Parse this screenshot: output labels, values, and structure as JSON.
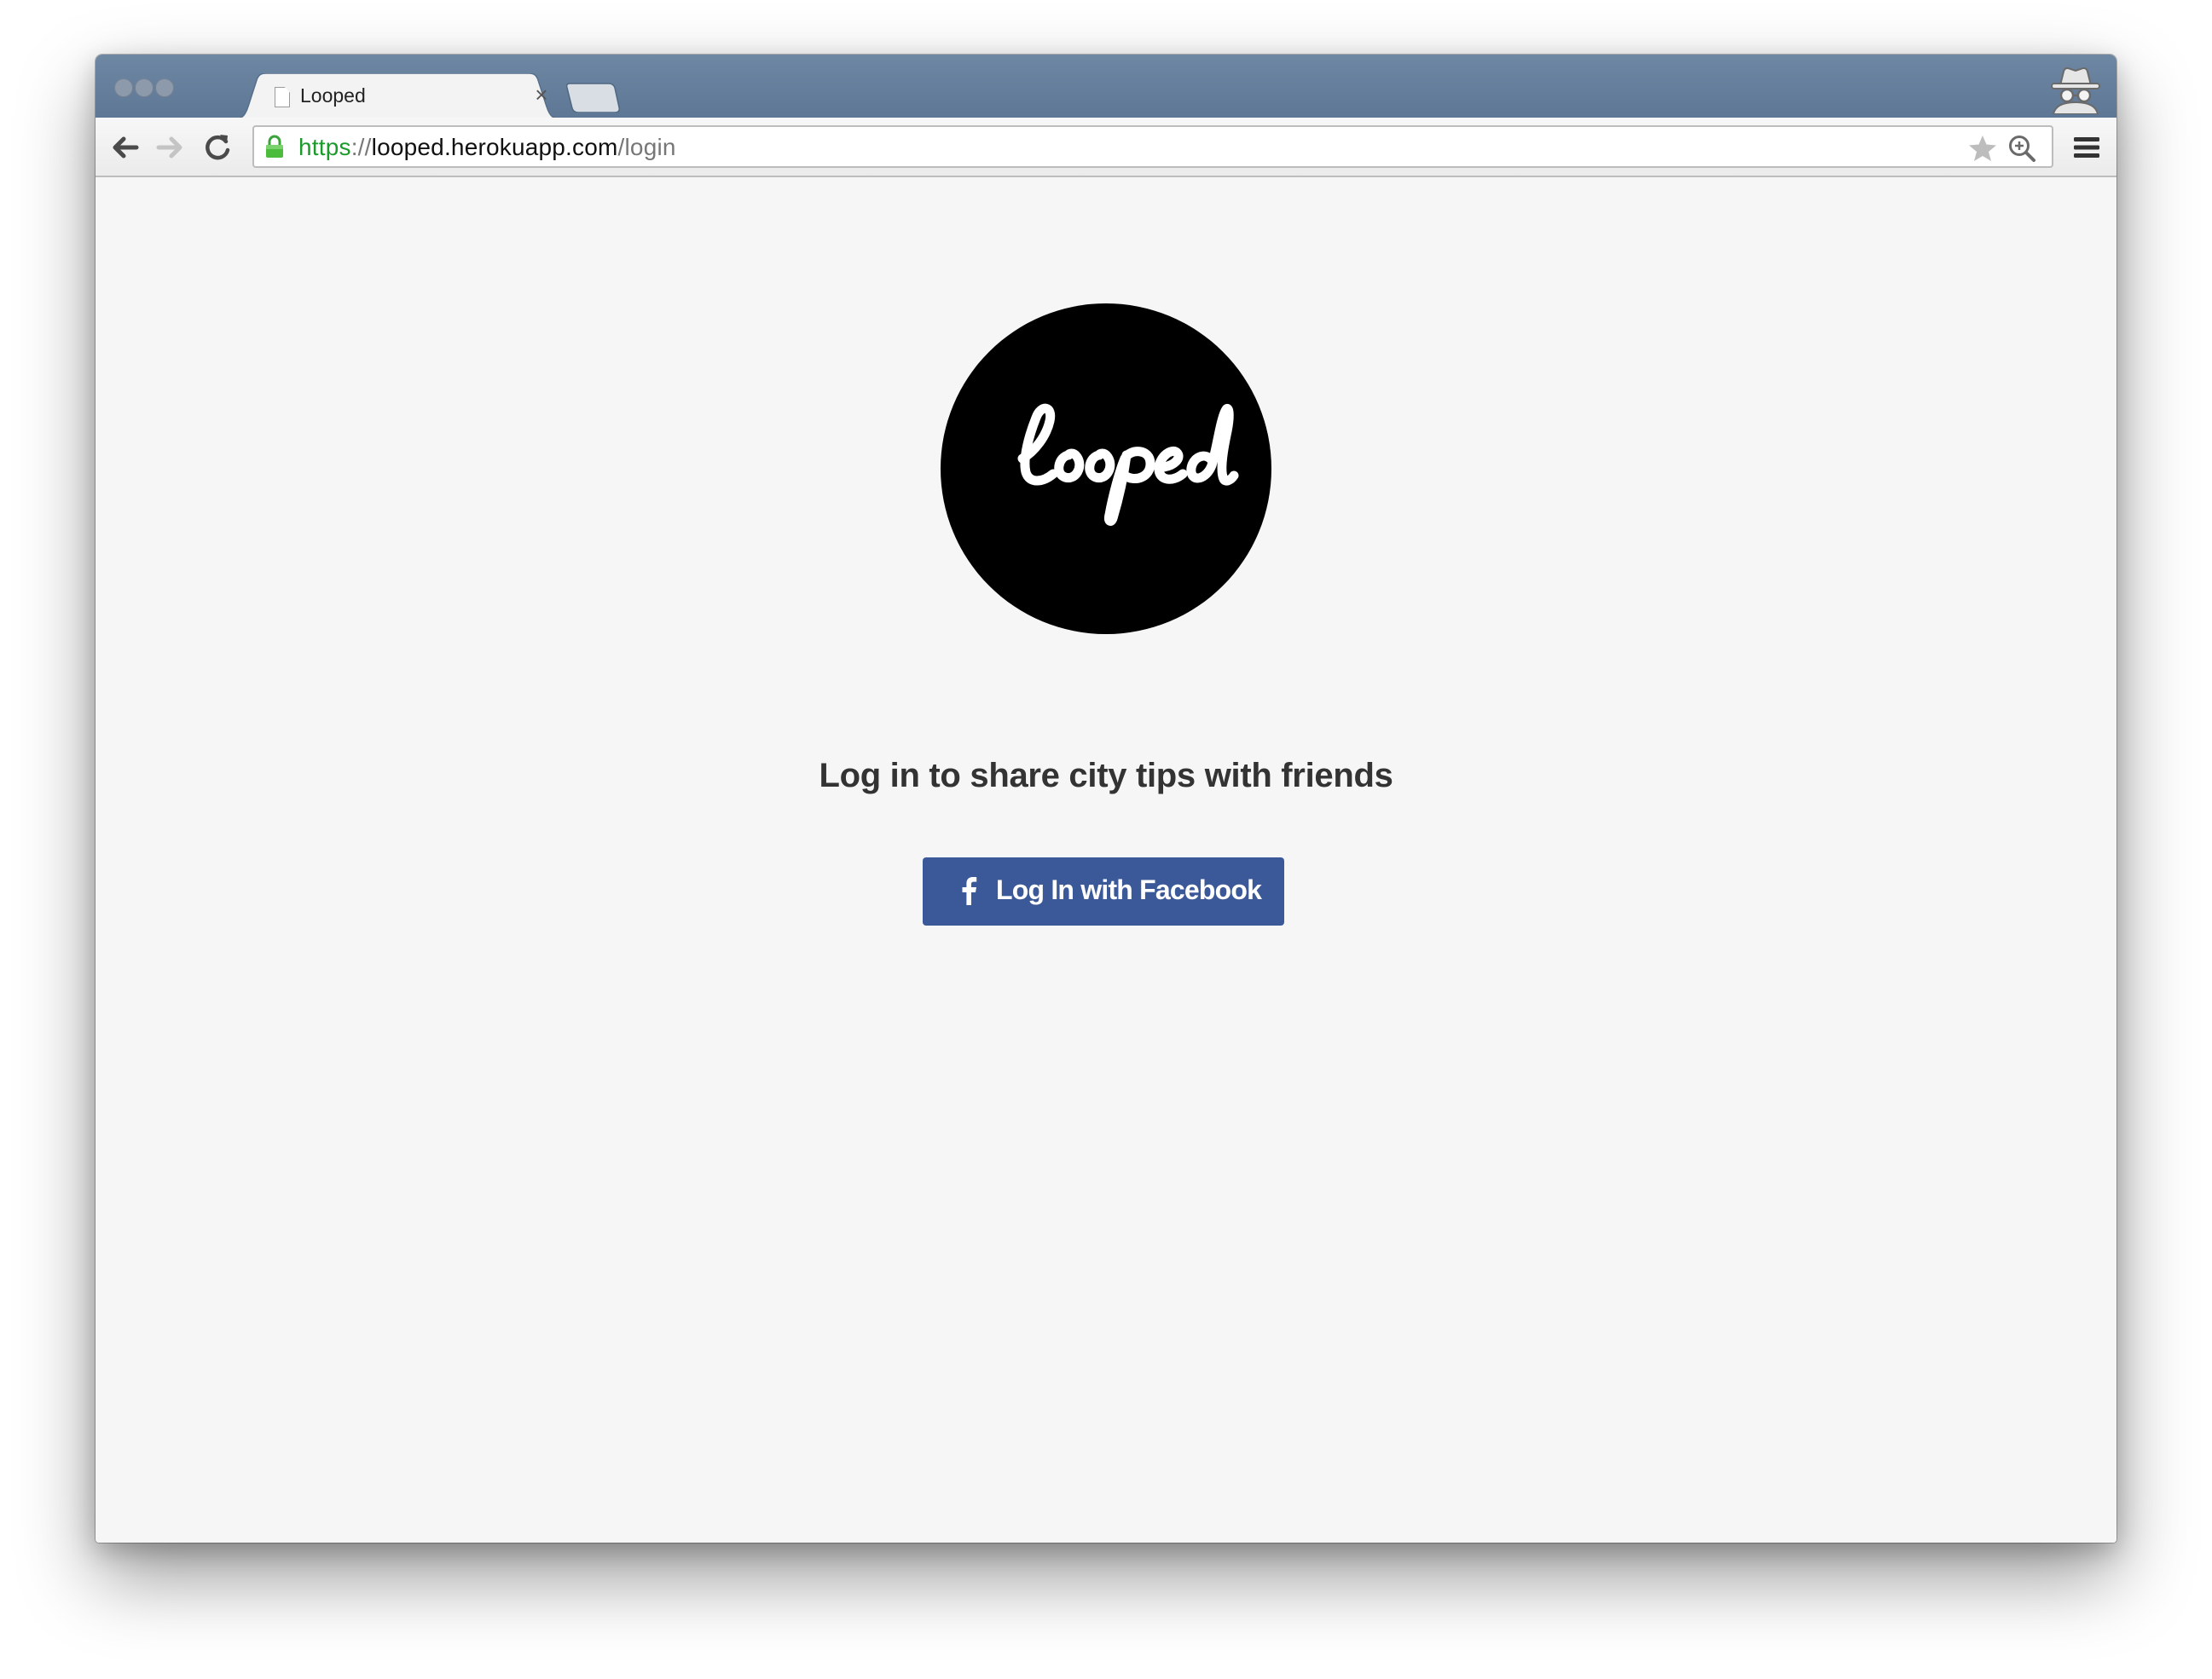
{
  "browser": {
    "tab": {
      "title": "Looped",
      "close_glyph": "×"
    },
    "url": {
      "scheme": "https",
      "separator": "://",
      "host": "looped.herokuapp.com",
      "path": "/login"
    },
    "icons": {
      "back": "back-arrow-icon",
      "forward": "forward-arrow-icon",
      "reload": "reload-icon",
      "lock": "lock-icon",
      "bookmark": "star-icon",
      "zoom": "zoom-icon",
      "menu": "hamburger-menu-icon",
      "profile": "incognito-icon"
    },
    "colors": {
      "tabstrip": "#5d7795",
      "secure_scheme": "#1c9a2b"
    }
  },
  "page": {
    "logo_text": "looped",
    "tagline": "Log in to share city tips with friends",
    "login_button": {
      "label": "Log In with Facebook",
      "icon": "facebook-icon",
      "color": "#3b5998"
    }
  }
}
